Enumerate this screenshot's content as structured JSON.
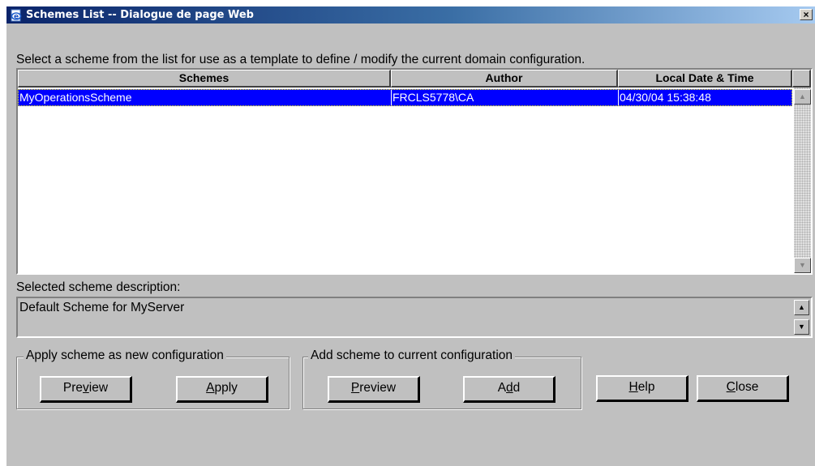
{
  "window": {
    "title": "Schemes List -- Dialogue de page Web",
    "close_glyph": "×",
    "title_icon": "ie-page-icon"
  },
  "instruction": "Select a scheme from the list for use as a template to define / modify the current domain configuration.",
  "table": {
    "columns": [
      "Schemes",
      "Author",
      "Local Date & Time"
    ],
    "rows": [
      {
        "scheme": "MyOperationsScheme",
        "author": "FRCLS5778\\CA",
        "datetime": "04/30/04 15:38:48",
        "selected": true
      }
    ],
    "scroll_up": "▲",
    "scroll_down": "▼"
  },
  "description": {
    "label": "Selected scheme description:",
    "value": "Default Scheme for MyServer",
    "scroll_up": "▲",
    "scroll_down": "▼"
  },
  "apply_group": {
    "legend": "Apply scheme as new configuration",
    "preview_pre": "Pre",
    "preview_mn": "v",
    "preview_post": "iew",
    "apply_pre": "",
    "apply_mn": "A",
    "apply_post": "pply"
  },
  "add_group": {
    "legend": "Add scheme to current configuration",
    "preview_pre": "",
    "preview_mn": "P",
    "preview_post": "review",
    "add_pre": "A",
    "add_mn": "d",
    "add_post": "d"
  },
  "help": {
    "pre": "",
    "mn": "H",
    "post": "elp"
  },
  "close": {
    "pre": "",
    "mn": "C",
    "post": "lose"
  },
  "colors": {
    "dialog_bg": "#c0c0c0",
    "selection_bg": "#0000ff",
    "title_start": "#0a246a"
  }
}
